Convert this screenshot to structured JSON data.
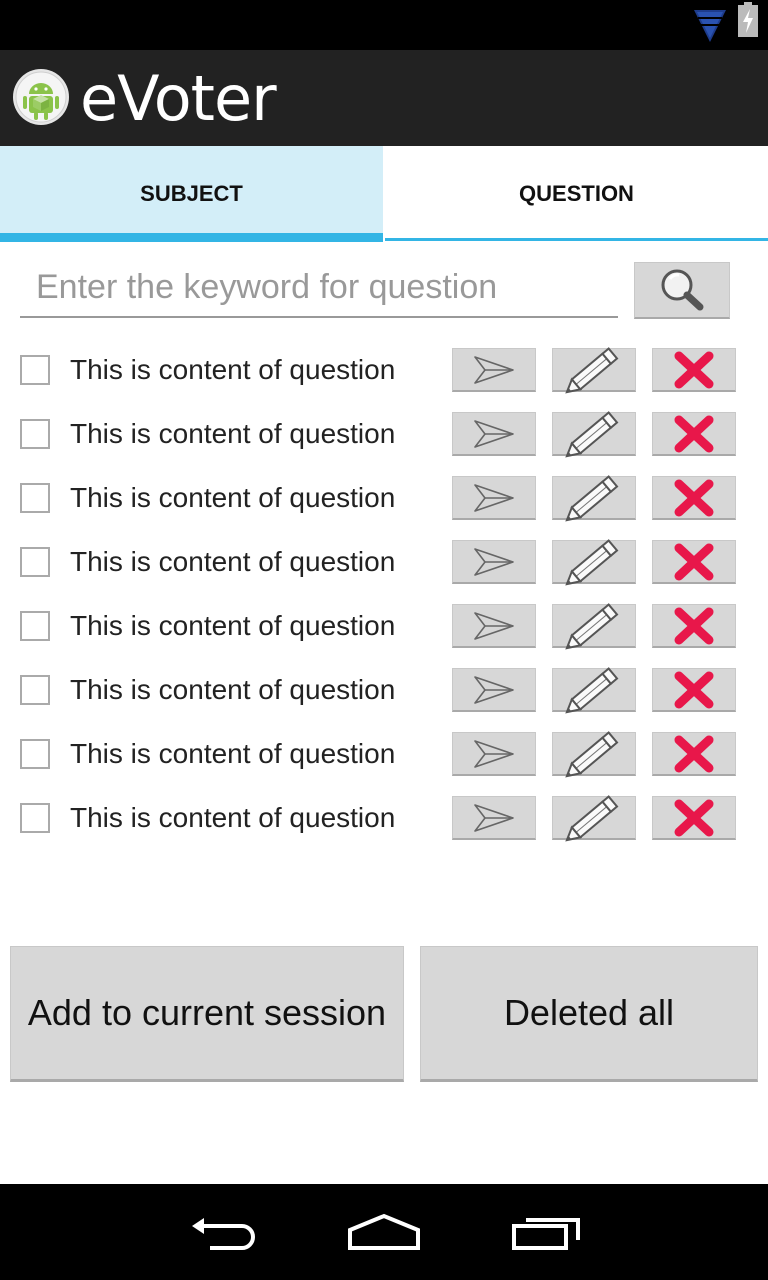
{
  "app": {
    "title": "eVoter"
  },
  "tabs": [
    {
      "label": "SUBJECT",
      "active": true
    },
    {
      "label": "QUESTION",
      "active": false
    }
  ],
  "search": {
    "placeholder": "Enter the keyword for question",
    "value": ""
  },
  "questions": [
    {
      "text": "This is content of question",
      "checked": false
    },
    {
      "text": "This is content of question",
      "checked": false
    },
    {
      "text": "This is content of question",
      "checked": false
    },
    {
      "text": "This is content of question",
      "checked": false
    },
    {
      "text": "This is content of question",
      "checked": false
    },
    {
      "text": "This is content of question",
      "checked": false
    },
    {
      "text": "This is content of question",
      "checked": false
    },
    {
      "text": "This is content of question",
      "checked": false
    }
  ],
  "actions": {
    "add_label": "Add to current session",
    "delete_all_label": "Deleted all"
  },
  "colors": {
    "accent": "#33b5e5",
    "delete_x": "#e8174a",
    "actionbar": "#222222"
  },
  "icons": [
    "android-logo-icon",
    "wifi-icon",
    "battery-icon",
    "search-icon",
    "send-icon",
    "pencil-icon",
    "delete-x-icon",
    "back-icon",
    "home-icon",
    "recent-apps-icon"
  ]
}
